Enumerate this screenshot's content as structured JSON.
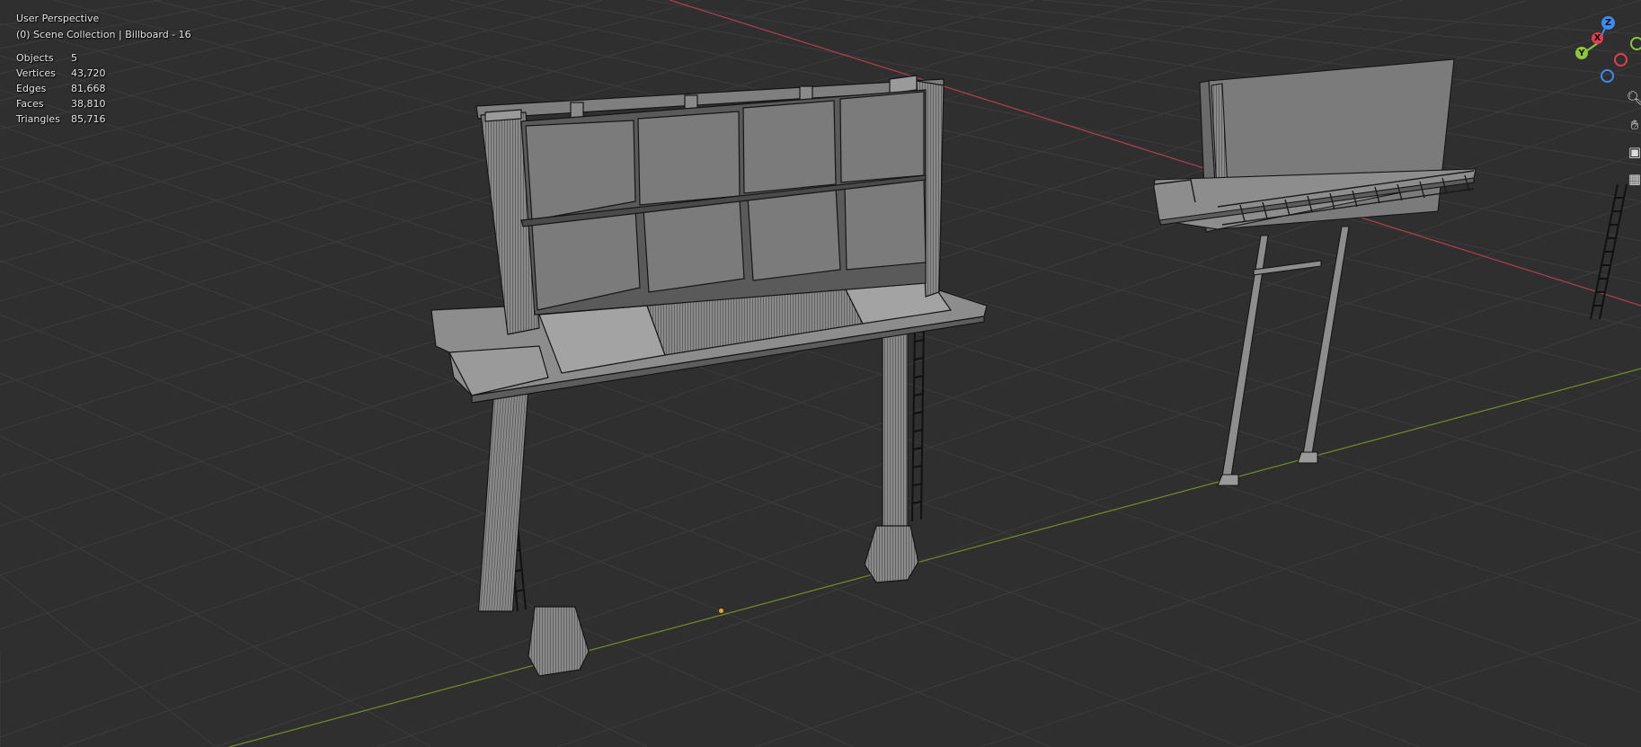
{
  "viewport": {
    "view_name": "User Perspective",
    "collection_text": "(0) Scene Collection | Billboard - 16"
  },
  "stats": [
    {
      "label": "Objects",
      "value": "5"
    },
    {
      "label": "Vertices",
      "value": "43,720"
    },
    {
      "label": "Edges",
      "value": "81,668"
    },
    {
      "label": "Faces",
      "value": "38,810"
    },
    {
      "label": "Triangles",
      "value": "85,716"
    }
  ],
  "gizmo": {
    "z_label": "Z",
    "y_label": "Y",
    "x_label": "X",
    "colors": {
      "x": "#e04050",
      "y": "#8cc63f",
      "z": "#3d8cf0"
    }
  },
  "nav_icons": [
    "zoom-icon",
    "pan-hand-icon",
    "camera-icon",
    "grid-view-icon"
  ],
  "colors": {
    "background": "#2f2f2f",
    "grid": "#3b3b3b",
    "x_axis": "#b2404e",
    "y_axis": "#6f8e2b",
    "mesh_face": "#7b7b7b",
    "mesh_edge": "#161616"
  }
}
